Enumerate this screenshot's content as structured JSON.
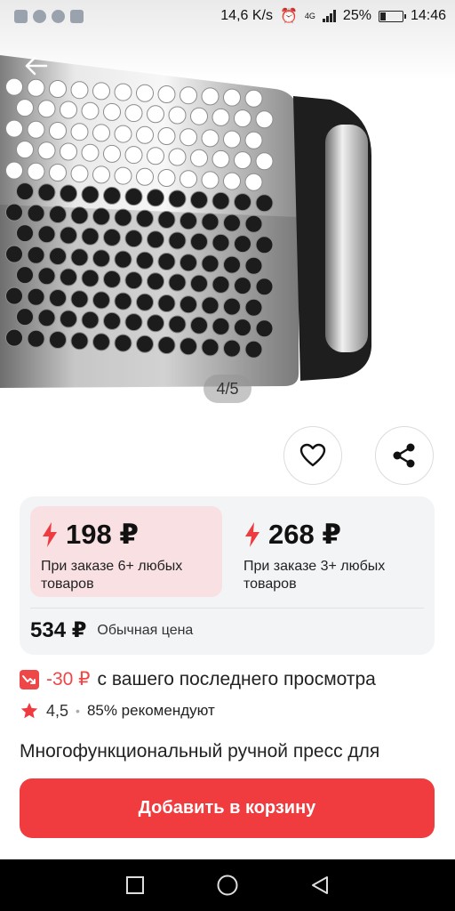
{
  "status_bar": {
    "speed": "14,6 K/s",
    "network": "4G",
    "battery_percent": "25%",
    "battery_level": 0.25,
    "time": "14:46"
  },
  "gallery": {
    "counter": "4/5"
  },
  "prices": {
    "tier1": {
      "price": "198 ₽",
      "description": "При заказе 6+ любых товаров"
    },
    "tier2": {
      "price": "268 ₽",
      "description": "При заказе 3+ любых товаров"
    },
    "regular": {
      "price": "534 ₽",
      "label": "Обычная цена"
    }
  },
  "discount": {
    "amount": "-30 ₽",
    "text": "с вашего последнего просмотра"
  },
  "rating": {
    "value": "4,5",
    "recommend": "85% рекомендуют"
  },
  "product": {
    "title": "Многофункциональный ручной пресс для"
  },
  "actions": {
    "add_to_cart": "Добавить в корзину"
  },
  "colors": {
    "accent": "#f03c3f",
    "tier_active_bg": "#f8e0e3",
    "card_bg": "#f3f4f6"
  },
  "icons": {
    "back": "arrow-left-icon",
    "favorite": "heart-icon",
    "share": "share-icon",
    "lightning": "lightning-icon",
    "price_drop": "price-drop-icon",
    "star": "star-icon"
  }
}
